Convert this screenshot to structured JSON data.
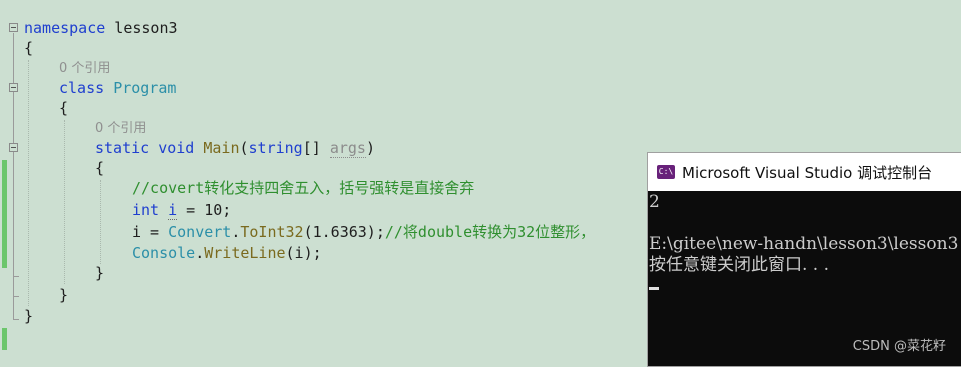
{
  "editor": {
    "line1": {
      "kw": "namespace",
      "name": " lesson3"
    },
    "line2": "{",
    "lens1": "0 个引用",
    "line3": {
      "kw": "class",
      "name": "Program"
    },
    "line4": "{",
    "lens2": "0 个引用",
    "line5": {
      "kw1": "static",
      "kw2": "void",
      "fn": "Main",
      "p1": "(",
      "kw3": "string",
      "p2": "[] ",
      "arg": "args",
      "p3": ")"
    },
    "line6": "{",
    "line7_comment": "//covert转化支持四舍五入，括号强转是直接舍弃",
    "line8": {
      "kw": "int",
      "var": "i",
      "rest": " = 10;"
    },
    "line9": {
      "a": "i = ",
      "ty": "Convert",
      "b": ".",
      "fn": "ToInt32",
      "c": "(1.6363);",
      "comment": "//将double转换为32位整形，"
    },
    "line10": {
      "ty": "Console",
      "b": ".",
      "fn": "WriteLine",
      "c": "(i);"
    },
    "line11": "}",
    "line12": "}",
    "line13": "}"
  },
  "console": {
    "icon": "C:\\",
    "title": "Microsoft Visual Studio 调试控制台",
    "lines": [
      "2",
      "",
      "E:\\gitee\\new-handn\\lesson3\\lesson3",
      "按任意键关闭此窗口. . ."
    ]
  },
  "watermark": "CSDN @菜花籽",
  "colors": {
    "background": "#ccdfd1",
    "keyword": "#1f3fcf",
    "type": "#2b8fa8",
    "comment": "#2f8f2f",
    "console_bg": "#0c0c0c"
  }
}
